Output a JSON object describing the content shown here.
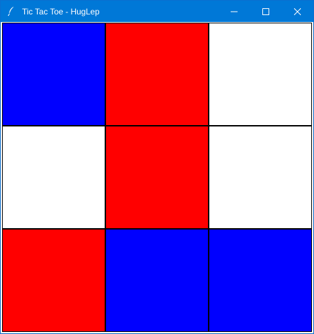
{
  "window": {
    "title": "Tic Tac Toe - HugLep",
    "icon": "feather-icon",
    "titlebar_color": "#0078d7",
    "controls": [
      "minimize-icon",
      "maximize-icon",
      "close-icon"
    ]
  },
  "colors": {
    "blue": "#0000ff",
    "red": "#ff0000",
    "white": "#ffffff",
    "grid_line": "#000000"
  },
  "board": {
    "rows": 3,
    "cols": 3,
    "cells": [
      [
        "blue",
        "red",
        "white"
      ],
      [
        "white",
        "red",
        "white"
      ],
      [
        "red",
        "blue",
        "blue"
      ]
    ]
  }
}
